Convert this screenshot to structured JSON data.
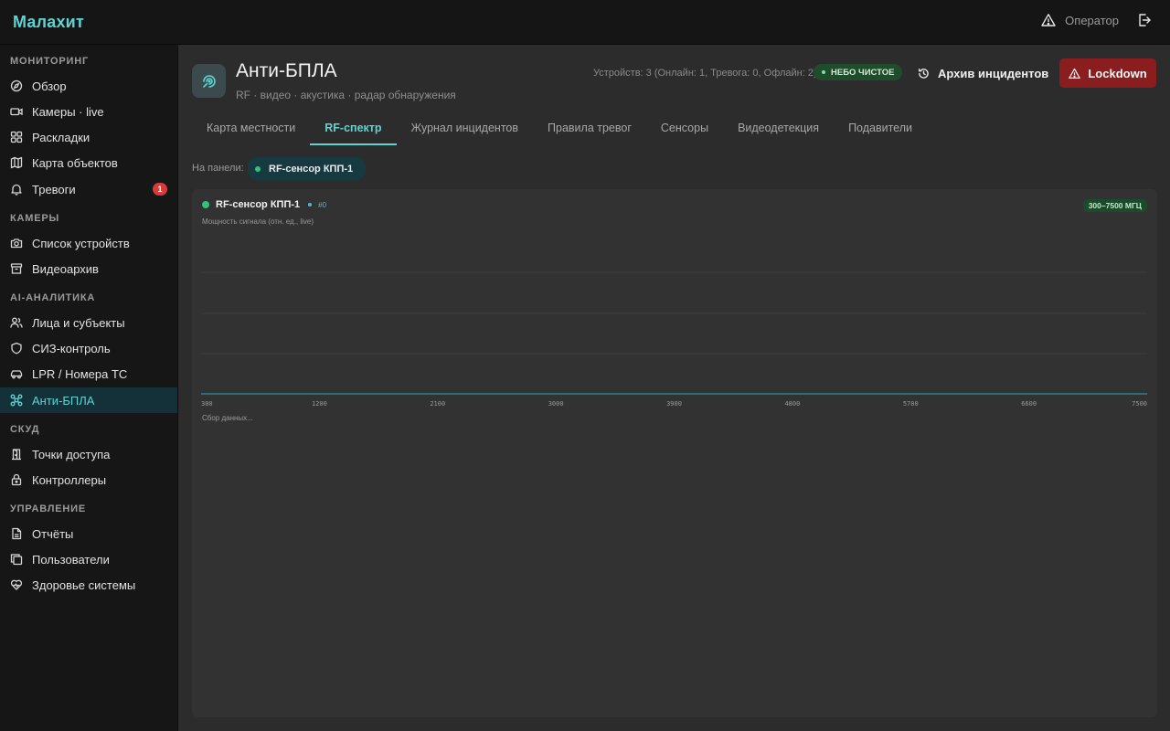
{
  "brand": "Малахит",
  "topbar": {
    "user_role": "Оператор"
  },
  "sidebar": {
    "sections": [
      {
        "title": "МОНИТОРИНГ",
        "items": [
          {
            "label": "Обзор",
            "icon": "compass-icon"
          },
          {
            "label": "Камеры · live",
            "icon": "video-icon"
          },
          {
            "label": "Раскладки",
            "icon": "grid-icon"
          },
          {
            "label": "Карта объектов",
            "icon": "map-icon"
          },
          {
            "label": "Тревоги",
            "icon": "bell-icon",
            "badge": "1"
          }
        ]
      },
      {
        "title": "КАМЕРЫ",
        "items": [
          {
            "label": "Список устройств",
            "icon": "camera-icon"
          },
          {
            "label": "Видеоархив",
            "icon": "archive-icon"
          }
        ]
      },
      {
        "title": "AI-АНАЛИТИКА",
        "items": [
          {
            "label": "Лица и субъекты",
            "icon": "users-icon"
          },
          {
            "label": "СИЗ-контроль",
            "icon": "shield-icon"
          },
          {
            "label": "LPR / Номера ТС",
            "icon": "car-icon"
          },
          {
            "label": "Анти-БПЛА",
            "icon": "drone-icon",
            "active": true
          }
        ]
      },
      {
        "title": "СКУД",
        "items": [
          {
            "label": "Точки доступа",
            "icon": "door-icon"
          },
          {
            "label": "Контроллеры",
            "icon": "lock-icon"
          }
        ]
      },
      {
        "title": "УПРАВЛЕНИЕ",
        "items": [
          {
            "label": "Отчёты",
            "icon": "report-icon"
          },
          {
            "label": "Пользователи",
            "icon": "copy-users-icon"
          },
          {
            "label": "Здоровье системы",
            "icon": "heart-pulse-icon"
          }
        ]
      }
    ]
  },
  "header": {
    "title": "Анти-БПЛА",
    "subtitle": "RF · видео · акустика · радар обнаружения",
    "device_stats": "Устройств: 3 (Онлайн: 1, Тревога: 0, Офлайн: 2)",
    "sky_status": "НЕБО ЧИСТОЕ",
    "archive_label": "Архив инцидентов",
    "lockdown_label": "Lockdown"
  },
  "tabs": [
    {
      "label": "Карта местности"
    },
    {
      "label": "RF-спектр",
      "active": true
    },
    {
      "label": "Журнал инцидентов"
    },
    {
      "label": "Правила тревог"
    },
    {
      "label": "Сенсоры"
    },
    {
      "label": "Видеодетекция"
    },
    {
      "label": "Подавители"
    }
  ],
  "panel_filter": {
    "label": "На панели:",
    "chip_label": "RF-сенсор КПП-1"
  },
  "card": {
    "sensor_name": "RF-сенсор КПП-1",
    "sensor_index": "#0",
    "freq_range": "300–7500 МГЦ",
    "y_label": "Мощность сигнала (отн. ед., live)",
    "status_text": "Сбор данных..."
  },
  "chart_data": {
    "type": "line",
    "title": "",
    "xlabel": "",
    "ylabel": "Мощность сигнала (отн. ед., live)",
    "x_ticks": [
      "300",
      "1200",
      "2100",
      "3000",
      "3900",
      "4800",
      "5700",
      "6600",
      "7500"
    ],
    "xlim": [
      300,
      7500
    ],
    "series": [],
    "grid": true,
    "accent_color": "#2a8fa8"
  },
  "colors": {
    "accent": "#5fd3d3",
    "danger": "#8a1d1d",
    "online": "#30c27a"
  }
}
